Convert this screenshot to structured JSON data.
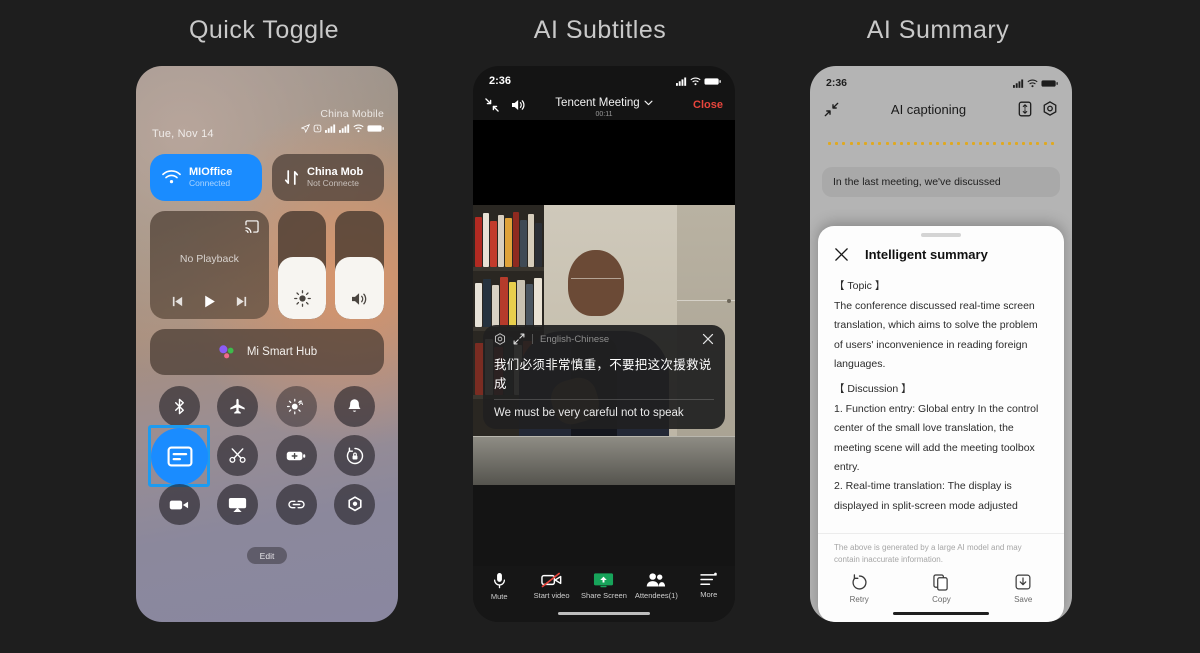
{
  "panels": [
    {
      "title": "Quick Toggle"
    },
    {
      "title": "AI Subtitles"
    },
    {
      "title": "AI Summary"
    }
  ],
  "quick_toggle": {
    "carrier": "China Mobile",
    "date": "Tue, Nov 14",
    "connectivity": [
      {
        "title": "MIOffice",
        "subtitle": "Connected",
        "state": "on",
        "icon": "wifi-icon"
      },
      {
        "title": "China Mob",
        "subtitle": "Not Connecte",
        "state": "off",
        "icon": "mobile-data-icon"
      }
    ],
    "media": {
      "label": "No Playback",
      "cast_icon": "cast-icon",
      "prev": "previous-icon",
      "play": "play-icon",
      "next": "next-icon"
    },
    "sliders": [
      {
        "name": "brightness",
        "icon": "brightness-icon",
        "level": 57
      },
      {
        "name": "volume",
        "icon": "volume-icon",
        "level": 57
      }
    ],
    "hub": {
      "label": "Mi Smart Hub",
      "icon": "mi-hub-icon"
    },
    "toggles": [
      {
        "name": "bluetooth",
        "icon": "bluetooth-icon",
        "active": false
      },
      {
        "name": "airplane-mode",
        "icon": "airplane-icon",
        "active": false
      },
      {
        "name": "auto-brightness",
        "icon": "auto-brightness-icon",
        "active": false
      },
      {
        "name": "ring-mode",
        "icon": "bell-icon",
        "active": false
      },
      {
        "name": "ai-subtitles",
        "icon": "caption-icon",
        "active": true,
        "highlighted": true
      },
      {
        "name": "screenshot-cut",
        "icon": "scissors-icon",
        "active": false
      },
      {
        "name": "battery-saver",
        "icon": "battery-plus-icon",
        "active": false
      },
      {
        "name": "rotation-lock",
        "icon": "rotation-lock-icon",
        "active": false
      },
      {
        "name": "screen-record",
        "icon": "video-camera-icon",
        "active": false
      },
      {
        "name": "cast-screen",
        "icon": "airplay-icon",
        "active": false
      },
      {
        "name": "link",
        "icon": "link-icon",
        "active": false
      },
      {
        "name": "settings",
        "icon": "gear-icon",
        "active": false
      }
    ],
    "edit_label": "Edit"
  },
  "ai_subtitles": {
    "status": {
      "time": "2:36",
      "icons": [
        "signal-icon",
        "wifi-icon",
        "battery-icon"
      ]
    },
    "nav": {
      "minimize_icon": "minimize-icon",
      "speaker_icon": "speaker-icon",
      "title": "Tencent Meeting",
      "chevron_icon": "chevron-down-icon",
      "duration": "00:11",
      "close_label": "Close"
    },
    "caption": {
      "settings_icon": "settings-target-icon",
      "resize_icon": "resize-icon",
      "language": "English-Chinese",
      "close_icon": "close-icon",
      "chinese": "我们必须非常慎重，不要把这次援救说成",
      "english": "We must be very careful not to speak"
    },
    "toolbar": [
      {
        "label": "Mute",
        "icon": "microphone-icon"
      },
      {
        "label": "Start video",
        "icon": "video-off-icon"
      },
      {
        "label": "Share Screen",
        "icon": "share-screen-icon"
      },
      {
        "label": "Attendees(1)",
        "icon": "attendees-icon"
      },
      {
        "label": "More",
        "icon": "more-icon"
      }
    ]
  },
  "ai_summary": {
    "status": {
      "time": "2:36",
      "icons": [
        "signal-icon",
        "wifi-icon",
        "battery-icon"
      ]
    },
    "nav": {
      "minimize_icon": "minimize-icon",
      "title": "AI captioning",
      "transcript_icon": "transcript-icon",
      "settings_icon": "settings-hex-icon"
    },
    "transcript_bubble": "In the last meeting, we've discussed",
    "sheet": {
      "close_icon": "close-icon",
      "title": "Intelligent summary",
      "sections": [
        {
          "label": "【 Topic 】",
          "text": "The conference discussed real-time screen translation, which aims to solve the problem of users' inconvenience in reading foreign languages."
        },
        {
          "label": "【 Discussion 】",
          "text": "1. Function entry: Global entry In the control center of the small love translation, the meeting scene will add the meeting toolbox entry.\n2. Real-time translation: The display is displayed in split-screen mode adjusted"
        }
      ],
      "disclaimer": "The above is generated by a large AI model and may contain inaccurate information.",
      "actions": [
        {
          "label": "Retry",
          "icon": "retry-icon"
        },
        {
          "label": "Copy",
          "icon": "copy-icon"
        },
        {
          "label": "Save",
          "icon": "save-icon"
        }
      ]
    }
  },
  "colors": {
    "background": "#1e1e1e",
    "accent_blue": "#1a8cff",
    "highlight_border": "#1d9bf0",
    "close_red": "#e8453c",
    "dots_gold": "#e0a920",
    "share_green": "#17a45a"
  }
}
